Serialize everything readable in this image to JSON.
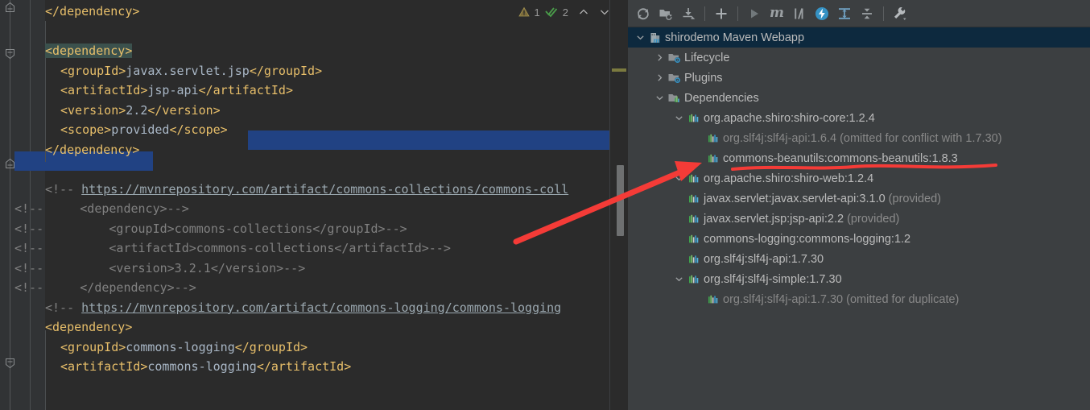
{
  "editor": {
    "inspections": {
      "warning_icon": "warning-triangle-icon",
      "warning_count": "1",
      "ok_icon": "double-check-icon",
      "ok_count": "2",
      "prev_icon": "chevron-up-icon",
      "next_icon": "chevron-down-icon"
    },
    "lines": [
      {
        "indent": 56,
        "parts": [
          {
            "t": "</dependency>",
            "c": "tag"
          }
        ]
      },
      {
        "indent": 56,
        "parts": []
      },
      {
        "indent": 56,
        "parts": [
          {
            "t": "<dependency>",
            "c": "tag hl-brace"
          }
        ]
      },
      {
        "indent": 75,
        "parts": [
          {
            "t": "<groupId>",
            "c": "tag"
          },
          {
            "t": "javax.servlet.jsp",
            "c": "txt"
          },
          {
            "t": "</groupId>",
            "c": "tag"
          }
        ]
      },
      {
        "indent": 75,
        "parts": [
          {
            "t": "<artifactId>",
            "c": "tag"
          },
          {
            "t": "jsp-api",
            "c": "txt"
          },
          {
            "t": "</artifactId>",
            "c": "tag"
          }
        ]
      },
      {
        "indent": 75,
        "parts": [
          {
            "t": "<version>",
            "c": "tag"
          },
          {
            "t": "2.2",
            "c": "txt"
          },
          {
            "t": "</version>",
            "c": "tag"
          }
        ]
      },
      {
        "indent": 75,
        "parts": [
          {
            "t": "<scope>",
            "c": "tag"
          },
          {
            "t": "provided",
            "c": "txt"
          },
          {
            "t": "</scope>",
            "c": "tag"
          }
        ]
      },
      {
        "indent": 56,
        "parts": [
          {
            "t": "</dependency>",
            "c": "tag"
          }
        ]
      },
      {
        "indent": 56,
        "parts": []
      },
      {
        "indent": 56,
        "parts": [
          {
            "t": "<!-- ",
            "c": "cmt"
          },
          {
            "t": "https://mvnrepository.com/artifact/commons-collections/commons-coll",
            "c": "url"
          }
        ]
      },
      {
        "indent": 18,
        "parts": [
          {
            "t": "<!--     <dependency>-->",
            "c": "cmt"
          }
        ]
      },
      {
        "indent": 18,
        "parts": [
          {
            "t": "<!--         <groupId>commons-collections</groupId>-->",
            "c": "cmt"
          }
        ]
      },
      {
        "indent": 18,
        "parts": [
          {
            "t": "<!--         <artifactId>commons-collections</artifactId>-->",
            "c": "cmt"
          }
        ]
      },
      {
        "indent": 18,
        "parts": [
          {
            "t": "<!--         <version>3.2.1</version>-->",
            "c": "cmt"
          }
        ]
      },
      {
        "indent": 18,
        "parts": [
          {
            "t": "<!--     </dependency>-->",
            "c": "cmt"
          }
        ]
      },
      {
        "indent": 56,
        "parts": [
          {
            "t": "<!-- ",
            "c": "cmt"
          },
          {
            "t": "https://mvnrepository.com/artifact/commons-logging/commons-logging",
            "c": "url"
          }
        ]
      },
      {
        "indent": 56,
        "parts": [
          {
            "t": "<dependency>",
            "c": "tag"
          }
        ]
      },
      {
        "indent": 75,
        "parts": [
          {
            "t": "<groupId>",
            "c": "tag"
          },
          {
            "t": "commons-logging",
            "c": "txt"
          },
          {
            "t": "</groupId>",
            "c": "tag"
          }
        ]
      },
      {
        "indent": 75,
        "parts": [
          {
            "t": "<artifactId>",
            "c": "tag"
          },
          {
            "t": "commons-logging",
            "c": "txt"
          },
          {
            "t": "</artifactId>",
            "c": "tag"
          }
        ]
      }
    ]
  },
  "maven": {
    "toolbar": [
      {
        "name": "reimport-icon",
        "title": "Reimport All Maven Projects"
      },
      {
        "name": "generate-sources-icon",
        "title": "Generate Sources and Update Folders"
      },
      {
        "name": "download-sources-icon",
        "title": "Download Sources and Documentation"
      },
      {
        "name": "add-maven-project-icon",
        "title": "Add Maven Projects"
      },
      {
        "name": "run-icon",
        "title": "Run Maven Build"
      },
      {
        "name": "execute-goal-icon",
        "title": "Execute Maven Goal"
      },
      {
        "name": "toggle-offline-icon",
        "title": "Toggle Offline Mode"
      },
      {
        "name": "toggle-skip-tests-icon",
        "title": "Toggle Skip Tests Mode"
      },
      {
        "name": "show-dependencies-icon",
        "title": "Show Dependencies"
      },
      {
        "name": "collapse-all-icon",
        "title": "Collapse All"
      },
      {
        "name": "settings-wrench-icon",
        "title": "Maven Settings"
      }
    ],
    "tree": [
      {
        "label": "shirodemo Maven Webapp",
        "indent": 0,
        "arrow": "down",
        "icon": "maven-project-icon",
        "selected": true,
        "style": "normal"
      },
      {
        "label": "Lifecycle",
        "indent": 1,
        "arrow": "right",
        "icon": "folder-gear-icon",
        "selected": false,
        "style": "normal"
      },
      {
        "label": "Plugins",
        "indent": 1,
        "arrow": "right",
        "icon": "folder-gear-icon",
        "selected": false,
        "style": "normal"
      },
      {
        "label": "Dependencies",
        "indent": 1,
        "arrow": "down",
        "icon": "folder-bars-icon",
        "selected": false,
        "style": "normal"
      },
      {
        "label": "org.apache.shiro:shiro-core:1.2.4",
        "indent": 2,
        "arrow": "down",
        "icon": "library-bars-icon",
        "selected": false,
        "style": "normal"
      },
      {
        "label": "org.slf4j:slf4j-api:1.6.4 (omitted for conflict with 1.7.30)",
        "indent": 3,
        "arrow": "none",
        "icon": "library-bars-icon",
        "selected": false,
        "style": "muted"
      },
      {
        "label": "commons-beanutils:commons-beanutils:1.8.3",
        "indent": 3,
        "arrow": "none",
        "icon": "library-bars-icon",
        "selected": false,
        "style": "normal"
      },
      {
        "label": "org.apache.shiro:shiro-web:1.2.4",
        "indent": 2,
        "arrow": "down",
        "icon": "library-bars-icon",
        "selected": false,
        "style": "normal"
      },
      {
        "label": "javax.servlet:javax.servlet-api:3.1.0",
        "suffix": " (provided)",
        "indent": 2,
        "arrow": "none",
        "icon": "library-bars-icon",
        "selected": false,
        "style": "normal"
      },
      {
        "label": "javax.servlet.jsp:jsp-api:2.2",
        "suffix": " (provided)",
        "indent": 2,
        "arrow": "none",
        "icon": "library-bars-icon",
        "selected": false,
        "style": "normal"
      },
      {
        "label": "commons-logging:commons-logging:1.2",
        "indent": 2,
        "arrow": "none",
        "icon": "library-bars-icon",
        "selected": false,
        "style": "normal"
      },
      {
        "label": "org.slf4j:slf4j-api:1.7.30",
        "indent": 2,
        "arrow": "none",
        "icon": "library-bars-icon",
        "selected": false,
        "style": "normal"
      },
      {
        "label": "org.slf4j:slf4j-simple:1.7.30",
        "indent": 2,
        "arrow": "down",
        "icon": "library-bars-icon",
        "selected": false,
        "style": "normal"
      },
      {
        "label": "org.slf4j:slf4j-api:1.7.30 (omitted for duplicate)",
        "indent": 3,
        "arrow": "none",
        "icon": "library-bars-icon",
        "selected": false,
        "style": "muted"
      }
    ]
  },
  "annotations": {
    "arrow_color": "#f43b37",
    "underline_color": "#f43b37",
    "arrow_label": "red-arrow-pointing-to-commons-beanutils",
    "underline_label": "red-underline-commons-beanutils"
  },
  "colors": {
    "editor_bg": "#2b2b2b",
    "gutter_bg": "#313335",
    "panel_bg": "#3c3f41",
    "selection_blue": "#214283",
    "tree_selected": "#0d293e",
    "tag": "#e8bf6a",
    "text": "#a9b7c6",
    "comment": "#808080"
  }
}
